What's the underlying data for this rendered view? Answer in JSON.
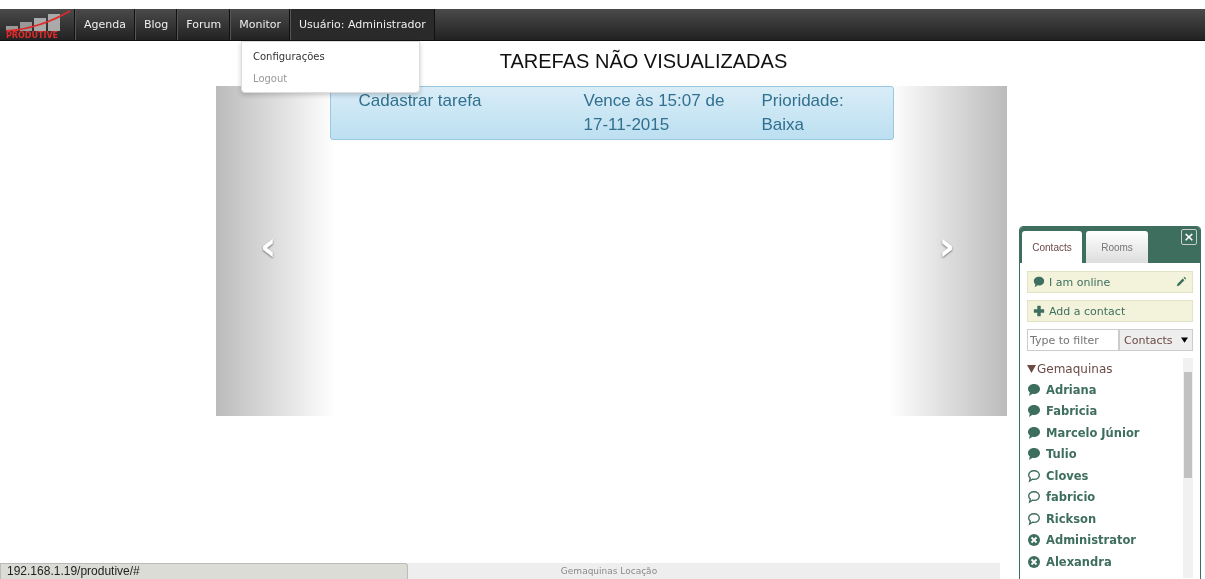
{
  "navbar": {
    "logo_text": "PRODUTIVE",
    "items": [
      {
        "label": "Agenda",
        "selected": false
      },
      {
        "label": "Blog",
        "selected": false
      },
      {
        "label": "Forum",
        "selected": false
      },
      {
        "label": "Monitor",
        "selected": false
      },
      {
        "label": "Usuário: Administrador",
        "selected": true
      }
    ],
    "dropdown": [
      {
        "label": "Configurações",
        "disabled": false
      },
      {
        "label": "Logout",
        "disabled": true
      }
    ]
  },
  "page_title": "TAREFAS NÃO VISUALIZADAS",
  "carousel": {
    "task": {
      "title": "Cadastrar tarefa",
      "due": "Vence às 15:07 de 17-11-2015",
      "priority": "Prioridade: Baixa"
    },
    "prev": "‹",
    "next": "›"
  },
  "chat": {
    "tabs": [
      {
        "label": "Contacts",
        "selected": true
      },
      {
        "label": "Rooms",
        "selected": false
      }
    ],
    "close": "×",
    "status": "I am online",
    "add": "Add a contact",
    "filter": {
      "placeholder": "Type to filter"
    },
    "filter_select": "Contacts",
    "group": {
      "name": "Gemaquinas",
      "expanded": true,
      "contacts": [
        {
          "name": "Adriana",
          "kind": "online"
        },
        {
          "name": "Fabricia",
          "kind": "online"
        },
        {
          "name": "Marcelo Júnior",
          "kind": "online"
        },
        {
          "name": "Tulio",
          "kind": "online"
        },
        {
          "name": "Cloves",
          "kind": "offline"
        },
        {
          "name": "fabricio",
          "kind": "offline"
        },
        {
          "name": "Rickson",
          "kind": "offline"
        },
        {
          "name": "Administrator",
          "kind": "busy"
        },
        {
          "name": "Alexandra",
          "kind": "busy"
        }
      ]
    }
  },
  "status_url": "192.168.1.19/produtive/#",
  "footer": "Gemaquinas Locação"
}
